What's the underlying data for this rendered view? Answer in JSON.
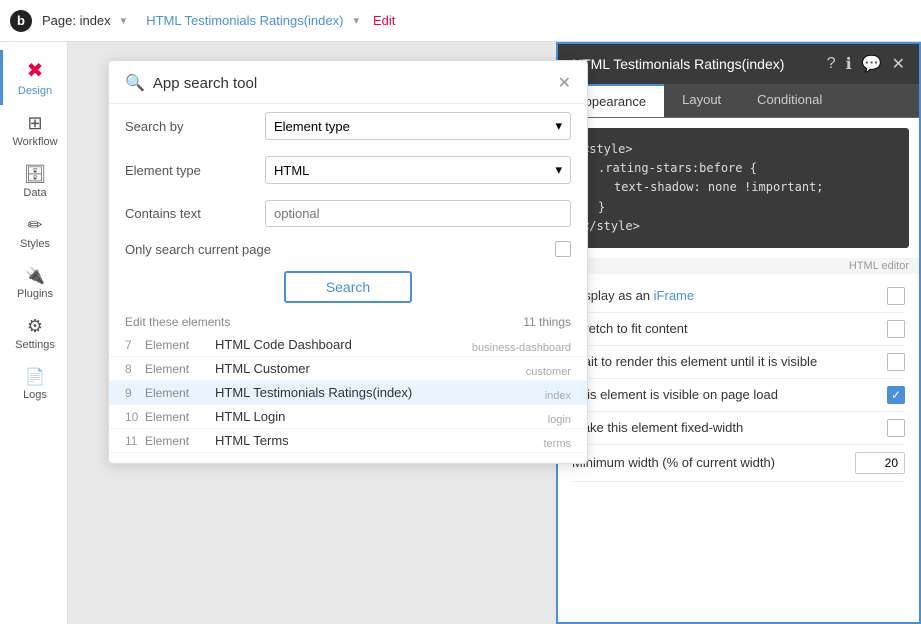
{
  "topbar": {
    "logo": "b",
    "page_label": "Page: index",
    "dropdown_arrow": "▾",
    "link_label": "HTML Testimonials Ratings(index)",
    "separator": "",
    "edit_label": "Edit"
  },
  "sidebar": {
    "items": [
      {
        "id": "design",
        "label": "Design",
        "icon": "✖",
        "active": true
      },
      {
        "id": "workflow",
        "label": "Workflow",
        "icon": "⊞"
      },
      {
        "id": "data",
        "label": "Data",
        "icon": "🗄"
      },
      {
        "id": "styles",
        "label": "Styles",
        "icon": "✏"
      },
      {
        "id": "plugins",
        "label": "Plugins",
        "icon": "🔌"
      },
      {
        "id": "settings",
        "label": "Settings",
        "icon": "⚙"
      },
      {
        "id": "logs",
        "label": "Logs",
        "icon": "📄"
      }
    ]
  },
  "search_panel": {
    "title": "App search tool",
    "search_by_label": "Search by",
    "search_by_value": "Element type",
    "element_type_label": "Element type",
    "element_type_value": "HTML",
    "contains_text_label": "Contains text",
    "contains_text_placeholder": "optional",
    "only_current_page_label": "Only search current page",
    "search_button": "Search",
    "results_edit_label": "Edit these elements",
    "results_count": "11 things",
    "results": [
      {
        "num": "7",
        "type": "Element",
        "name": "HTML Code Dashboard",
        "tag": "business-dashboard"
      },
      {
        "num": "8",
        "type": "Element",
        "name": "HTML Customer",
        "tag": "customer"
      },
      {
        "num": "9",
        "type": "Element",
        "name": "HTML Testimonials Ratings(index)",
        "tag": "index",
        "active": true
      },
      {
        "num": "10",
        "type": "Element",
        "name": "HTML Login",
        "tag": "login"
      },
      {
        "num": "11",
        "type": "Element",
        "name": "HTML Terms",
        "tag": "terms"
      }
    ]
  },
  "right_panel": {
    "title": "HTML Testimonials Ratings(index)",
    "icons": [
      "?",
      "ℹ",
      "💬",
      "✕"
    ],
    "tabs": [
      {
        "id": "appearance",
        "label": "Appearance",
        "active": true
      },
      {
        "id": "layout",
        "label": "Layout"
      },
      {
        "id": "conditional",
        "label": "Conditional"
      }
    ],
    "code_editor": {
      "lines": [
        "<style>",
        "  .rating-stars:before {",
        "    text-shadow: none !important;",
        "  }",
        "</style>"
      ],
      "footer_label": "HTML editor"
    },
    "settings": [
      {
        "id": "display-iframe",
        "label": "Display as an iFrame",
        "type": "checkbox",
        "checked": false
      },
      {
        "id": "stretch-content",
        "label": "Stretch to fit content",
        "type": "checkbox",
        "checked": false
      },
      {
        "id": "wait-render",
        "label": "Wait to render this element until it is visible",
        "type": "checkbox",
        "checked": false
      },
      {
        "id": "visible-on-load",
        "label": "This element is visible on page load",
        "type": "checkbox",
        "checked": true
      },
      {
        "id": "fixed-width",
        "label": "Make this element fixed-width",
        "type": "checkbox",
        "checked": false
      },
      {
        "id": "min-width",
        "label": "Minimum width (% of current width)",
        "type": "input",
        "value": "20"
      }
    ]
  }
}
